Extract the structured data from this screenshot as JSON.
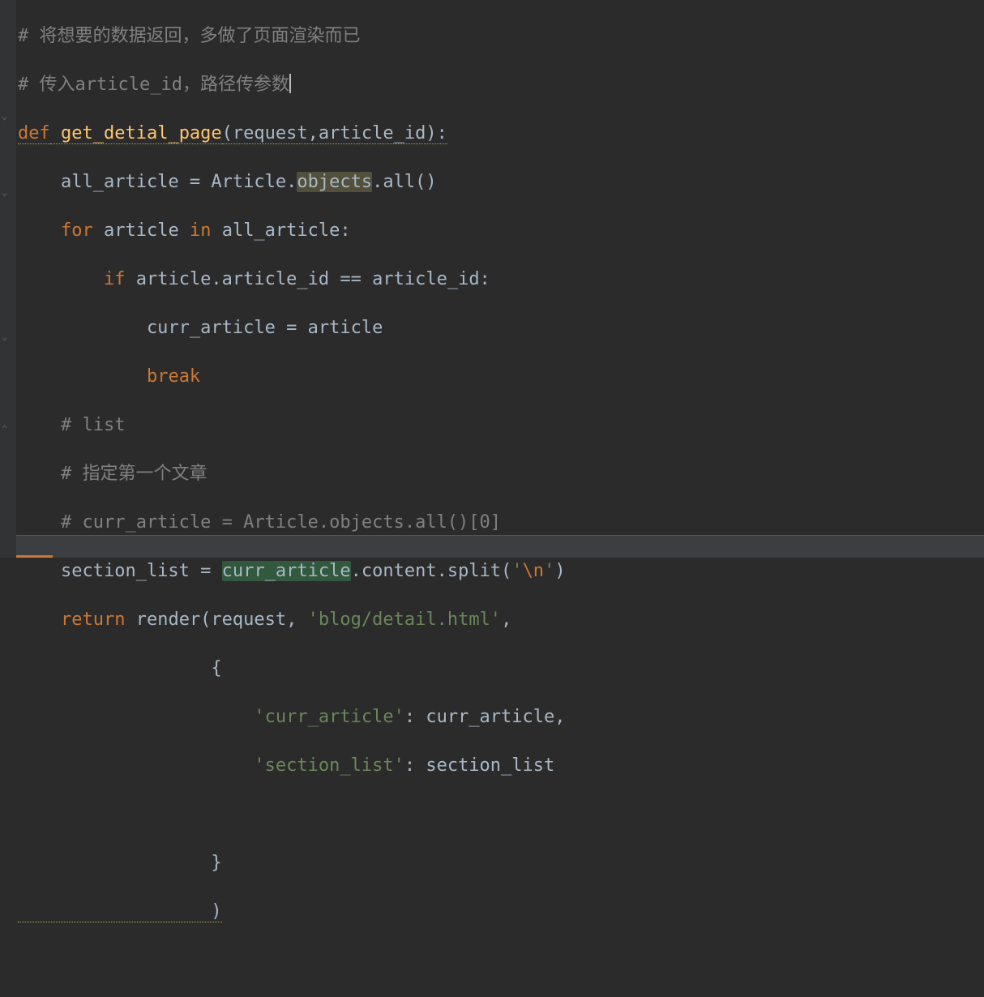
{
  "code": {
    "c1_prefix": "# ",
    "c1_text": "将想要的数据返回，多做了页面渲染而已",
    "c2_prefix": "# ",
    "c2_text": "传入article_id，路径传参数",
    "def": "def",
    "func": " get_detial_page",
    "params": "(request,article_id):",
    "assign1_a": "    all_article = Article.",
    "assign1_objects": "objects",
    "assign1_b": ".all()",
    "for_kw": "for",
    "for_mid": " article ",
    "in_kw": "in",
    "for_rest": " all_article:",
    "if_kw": "if",
    "if_rest": " article.article_id == article_id:",
    "curr_assign": "            curr_article = article",
    "break_kw": "break",
    "c3": "    # list",
    "c4": "    # 指定第一个文章",
    "c5": "    # curr_article = Article.objects.all()[0]",
    "sect_a": "    section_list = ",
    "sect_curr": "curr_article",
    "sect_b": ".content.split(",
    "str_open": "'",
    "esc": "\\n",
    "str_close": "'",
    "sect_c": ")",
    "ret_kw": "return",
    "render": " render(request, ",
    "tpl_str": "'blog/detail.html'",
    "comma": ",",
    "brace_open": "                  {",
    "d1_key": "'curr_article'",
    "d1_sep": ": curr_article,",
    "d2_key": "'section_list'",
    "d2_sep": ": section_list",
    "brace_close": "                  }",
    "paren_close": "                  )"
  }
}
